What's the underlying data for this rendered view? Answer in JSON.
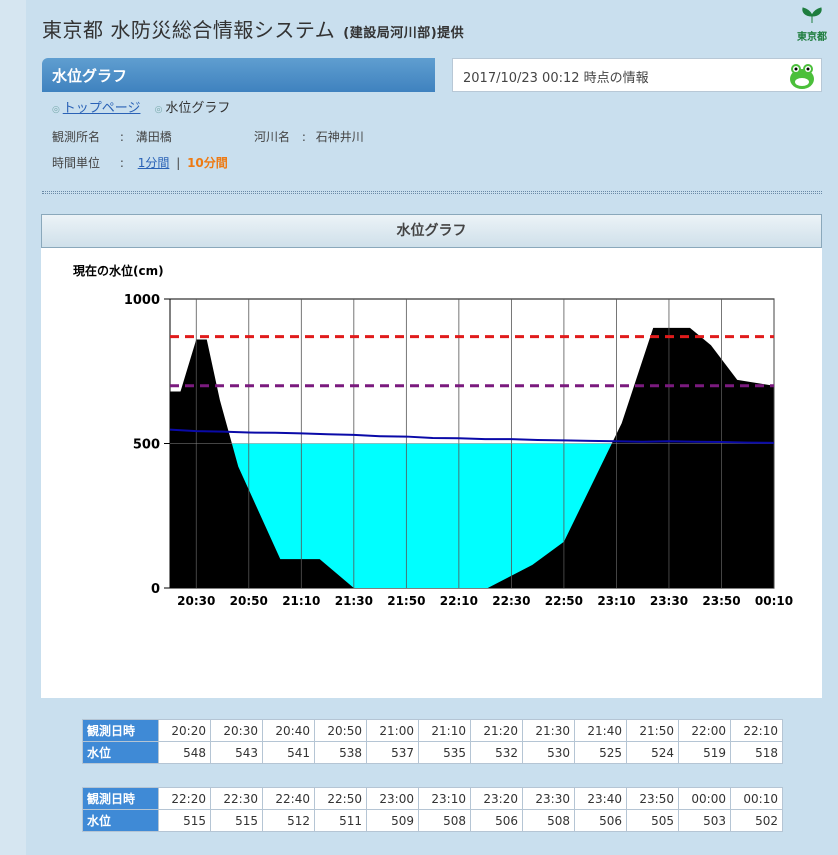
{
  "header": {
    "title": "東京都 水防災総合情報システム",
    "provider": "(建設局河川部)提供",
    "logo_text": "東京都"
  },
  "title_band": {
    "label": "水位グラフ"
  },
  "info": {
    "timestamp": "2017/10/23 00:12 時点の情報"
  },
  "breadcrumb": [
    {
      "label": "トップページ",
      "link": true
    },
    {
      "label": "水位グラフ",
      "link": false
    }
  ],
  "station": {
    "name_label": "観測所名",
    "name_value": "溝田橋",
    "river_label": "河川名",
    "river_value": "石神井川",
    "unit_label": "時間単位",
    "unit_1min": "1分間",
    "unit_sep": "|",
    "unit_10min": "10分間",
    "colon": ":"
  },
  "graph": {
    "heading": "水位グラフ"
  },
  "chart_data": {
    "type": "area",
    "ylabel": "現在の水位(cm)",
    "ylim": [
      0,
      1000
    ],
    "yticks": [
      0,
      500,
      1000
    ],
    "xticks": [
      "20:30",
      "20:50",
      "21:10",
      "21:30",
      "21:50",
      "22:10",
      "22:30",
      "22:50",
      "23:10",
      "23:30",
      "23:50",
      "00:10"
    ],
    "x_minutes_since_2020": [
      0,
      4,
      6,
      10,
      14,
      19,
      26,
      42,
      57,
      70,
      98,
      121,
      138,
      150,
      172,
      184,
      198,
      206,
      216,
      230
    ],
    "ground_profile_cm": [
      680,
      680,
      740,
      860,
      860,
      650,
      420,
      100,
      100,
      0,
      0,
      0,
      80,
      160,
      570,
      900,
      900,
      840,
      720,
      700
    ],
    "water_level_line_cm": [
      548,
      543,
      541,
      538,
      537,
      535,
      532,
      530,
      525,
      524,
      519,
      518,
      515,
      515,
      512,
      511,
      509,
      508,
      506,
      508,
      506,
      505,
      503,
      502
    ],
    "water_fill_cm": 500,
    "thresholds": [
      {
        "value": 870,
        "color": "#e01b1b"
      },
      {
        "value": 700,
        "color": "#7a1a7e"
      }
    ],
    "colors": {
      "ground": "#000000",
      "water": "#00ffff",
      "line": "#0a0aa8"
    }
  },
  "table1": {
    "time_header": "観測日時",
    "level_header": "水位",
    "times": [
      "20:20",
      "20:30",
      "20:40",
      "20:50",
      "21:00",
      "21:10",
      "21:20",
      "21:30",
      "21:40",
      "21:50",
      "22:00",
      "22:10"
    ],
    "levels": [
      "548",
      "543",
      "541",
      "538",
      "537",
      "535",
      "532",
      "530",
      "525",
      "524",
      "519",
      "518"
    ]
  },
  "table2": {
    "time_header": "観測日時",
    "level_header": "水位",
    "times": [
      "22:20",
      "22:30",
      "22:40",
      "22:50",
      "23:00",
      "23:10",
      "23:20",
      "23:30",
      "23:40",
      "23:50",
      "00:00",
      "00:10"
    ],
    "levels": [
      "515",
      "515",
      "512",
      "511",
      "509",
      "508",
      "506",
      "508",
      "506",
      "505",
      "503",
      "502"
    ]
  }
}
